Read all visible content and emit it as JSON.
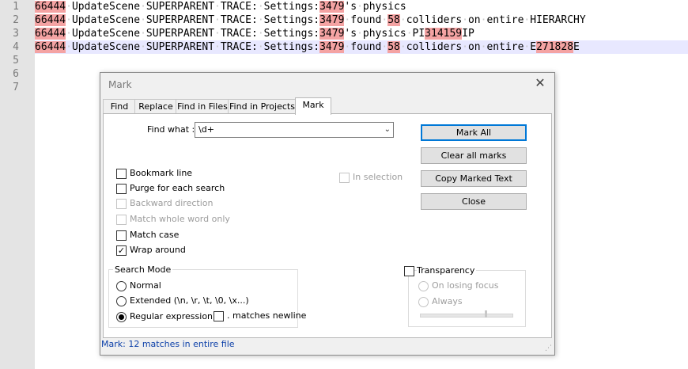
{
  "editor": {
    "line_numbers": [
      "1",
      "2",
      "3",
      "4",
      "5",
      "6",
      "7"
    ],
    "lines": [
      [
        [
          "66444",
          1
        ],
        [
          " UpdateScene SUPERPARENT TRACE: Settings:",
          0
        ],
        [
          "3479",
          1
        ],
        [
          "'s physics",
          0
        ]
      ],
      [
        [
          "66444",
          1
        ],
        [
          " UpdateScene SUPERPARENT TRACE: Settings:",
          0
        ],
        [
          "3479",
          1
        ],
        [
          " found ",
          0
        ],
        [
          "58",
          1
        ],
        [
          " colliders on entire HIERARCHY",
          0
        ]
      ],
      [
        [
          "66444",
          1
        ],
        [
          " UpdateScene SUPERPARENT TRACE: Settings:",
          0
        ],
        [
          "3479",
          1
        ],
        [
          "'s physics PI",
          0
        ],
        [
          "314159",
          1
        ],
        [
          "IP",
          0
        ]
      ],
      [
        [
          "66444",
          1
        ],
        [
          " UpdateScene SUPERPARENT TRACE: Settings:",
          0
        ],
        [
          "3479",
          1
        ],
        [
          " found ",
          0
        ],
        [
          "58",
          1
        ],
        [
          " colliders on entire E",
          0
        ],
        [
          "271828",
          1
        ],
        [
          "E",
          0
        ]
      ]
    ],
    "current_line": 4,
    "highlight_color": "#f4a3a3"
  },
  "dialog": {
    "title": "Mark",
    "close_glyph": "✕",
    "tabs": [
      "Find",
      "Replace",
      "Find in Files",
      "Find in Projects",
      "Mark"
    ],
    "active_tab": "Mark",
    "find_what_label": "Find what :",
    "find_what_value": "\\d+",
    "buttons": {
      "mark_all": "Mark All",
      "clear_all_marks": "Clear all marks",
      "copy_marked_text": "Copy Marked Text",
      "close": "Close"
    },
    "options": {
      "bookmark_line": {
        "label": "Bookmark line",
        "checked": false,
        "enabled": true
      },
      "purge": {
        "label": "Purge for each search",
        "checked": false,
        "enabled": true
      },
      "backward": {
        "label": "Backward direction",
        "checked": false,
        "enabled": false
      },
      "whole_word": {
        "label": "Match whole word only",
        "checked": false,
        "enabled": false
      },
      "match_case": {
        "label": "Match case",
        "checked": false,
        "enabled": true
      },
      "wrap_around": {
        "label": "Wrap around",
        "checked": true,
        "enabled": true
      },
      "in_selection": {
        "label": "In selection",
        "checked": false,
        "enabled": false
      }
    },
    "search_mode": {
      "title": "Search Mode",
      "normal": "Normal",
      "extended": "Extended (\\n, \\r, \\t, \\0, \\x...)",
      "regex": "Regular expression",
      "selected": "regex",
      "dot_newline_label": ". matches newline",
      "dot_newline_checked": false
    },
    "transparency": {
      "label": "Transparency",
      "checked": false,
      "on_losing_focus": "On losing focus",
      "always": "Always"
    },
    "status": "Mark: 12 matches in entire file",
    "accent_color": "#0078d7",
    "status_color": "#0b3fa8"
  }
}
